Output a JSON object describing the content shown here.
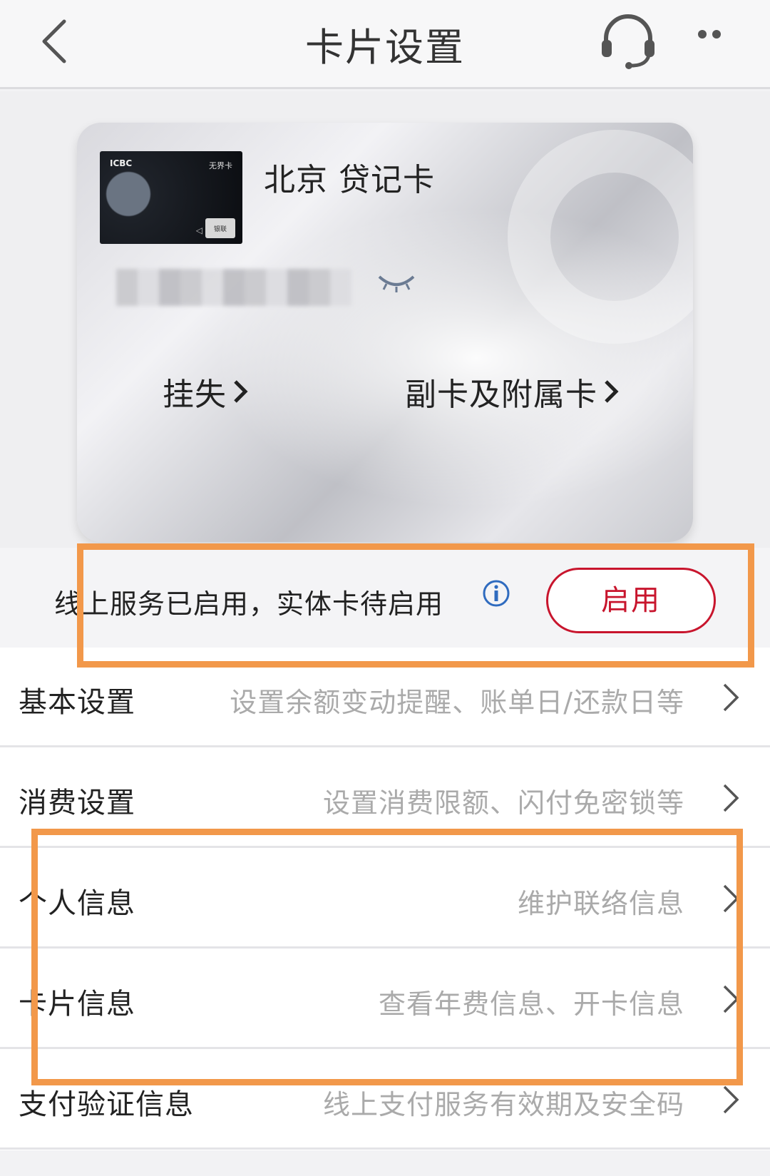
{
  "nav": {
    "title": "卡片设置",
    "back_icon": "chevron-left-icon",
    "service_icon": "headset-icon",
    "more_icon": "more-icon"
  },
  "card": {
    "name": "北京 贷记卡",
    "thumb_logo": "ICBC",
    "thumb_label": "无界卡",
    "thumb_network": "银联",
    "links": {
      "report_loss": "挂失",
      "supplementary": "副卡及附属卡"
    }
  },
  "status": {
    "text": "线上服务已启用，实体卡待启用",
    "activate_label": "启用"
  },
  "settings": [
    {
      "label": "基本设置",
      "desc": "设置余额变动提醒、账单日/还款日等"
    },
    {
      "label": "消费设置",
      "desc": "设置消费限额、闪付免密锁等"
    },
    {
      "label": "个人信息",
      "desc": "维护联络信息"
    },
    {
      "label": "卡片信息",
      "desc": "查看年费信息、开卡信息"
    },
    {
      "label": "支付验证信息",
      "desc": "线上支付服务有效期及安全码"
    }
  ],
  "colors": {
    "accent_red": "#c8152d",
    "info_blue": "#2f6bbf",
    "highlight_orange": "#f2984a"
  }
}
